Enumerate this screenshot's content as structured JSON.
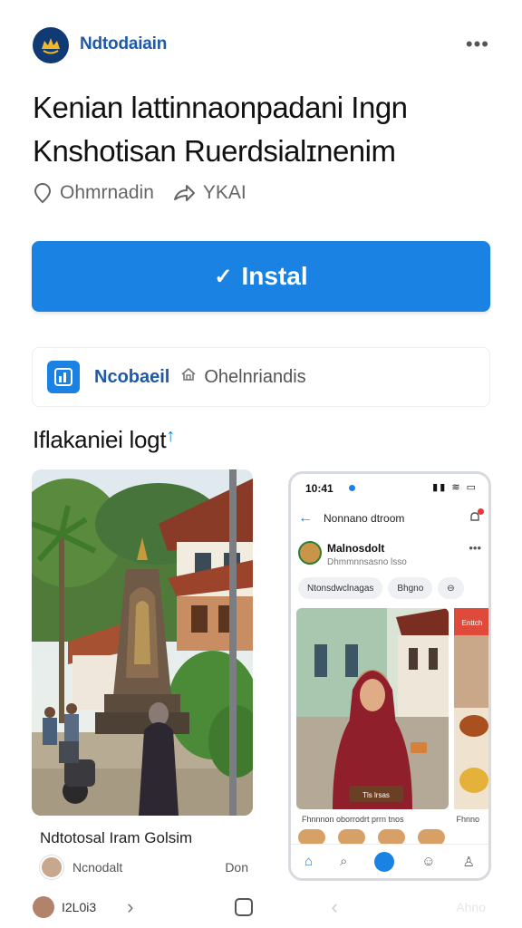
{
  "header": {
    "app_name": "Ndtodaiain",
    "more_label": "•••"
  },
  "listing": {
    "title_line1": "Kenian lattinnaonpadani Ingn",
    "title_line2": "Knshotisan Ruerdsialɪnenim",
    "meta_location": "Ohmrnadin",
    "meta_share": "YKAI"
  },
  "install": {
    "check": "✓",
    "label": "Instal"
  },
  "developer": {
    "name": "Ncobaeil",
    "subtitle": "Ohelnriandis"
  },
  "section": {
    "heading": "Iflakaniei logt",
    "arrow": "↑"
  },
  "screens": {
    "card1_caption": "Ndtotosal Iram Golsim",
    "card1_user": "Ncnodalt",
    "card1_right": "Don"
  },
  "phone": {
    "time": "10:41",
    "signal": "▮▮ ≋ ▭",
    "topbar_title": "Nonnano dtroom",
    "profile_name": "Malnosdolt",
    "profile_sub": "Dhmmnnsasno lsso",
    "chips": [
      "Ntonsdwclnagas",
      "Bhgno",
      "⊖"
    ],
    "photo_caption": "Tls lrsas",
    "side_tag": "Enttch",
    "caption_left": "Fhnnnon oborrodrt prrn tnos",
    "caption_right": "Fhnno"
  },
  "systembar": {
    "label": "I2L0i3",
    "right": "Ahno"
  },
  "colors": {
    "accent": "#1a82e2",
    "brand_dark": "#0f3a73",
    "link": "#1f5aa8"
  }
}
